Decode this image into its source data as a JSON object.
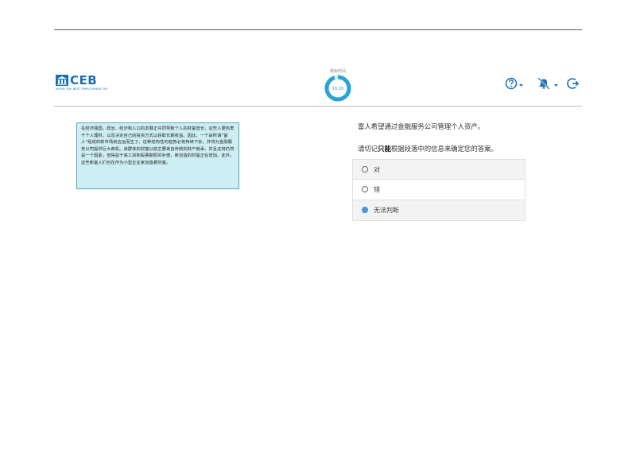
{
  "header": {
    "brand": "CEB",
    "tagline": "SHOW THE BEST EMPLOYMENT ON",
    "timer_label": "剩余时间",
    "timer_value": "16:10",
    "timer_progress": 0.95,
    "accent_color": "#1a6fb3",
    "icons": [
      "help-circle-icon",
      "bell-off-icon",
      "logout-icon"
    ]
  },
  "passage": {
    "text": "在经济强国，政治、经济和人口的发展正共同导致个人的财富增长，这些人更热衷于个人理财，以及决定自己的投资方式以获取长期收益。因此，一个由所谓“富人”组成的新市场就应运而生了。这种结构性的趋势必将持续下去，并将为金融服务公司提供巨大商机。该群体的财富以前主要来自传统的财产继承，并且这将仍然是一个因素，但得益于高工资和股票期权的补偿，新创造的财富正在增加。此外，这些新富人们也在作为小型企业家创造着财富。"
  },
  "question": {
    "statement": "富人希望通过金融服务公司管理个人资产。",
    "instruction_prefix": "请切记",
    "instruction_bold": "只能",
    "instruction_suffix": "根据段落中的信息来确定您的答案。"
  },
  "options": [
    {
      "label": "对",
      "selected": false
    },
    {
      "label": "错",
      "selected": false
    },
    {
      "label": "无法判断",
      "selected": true
    }
  ]
}
